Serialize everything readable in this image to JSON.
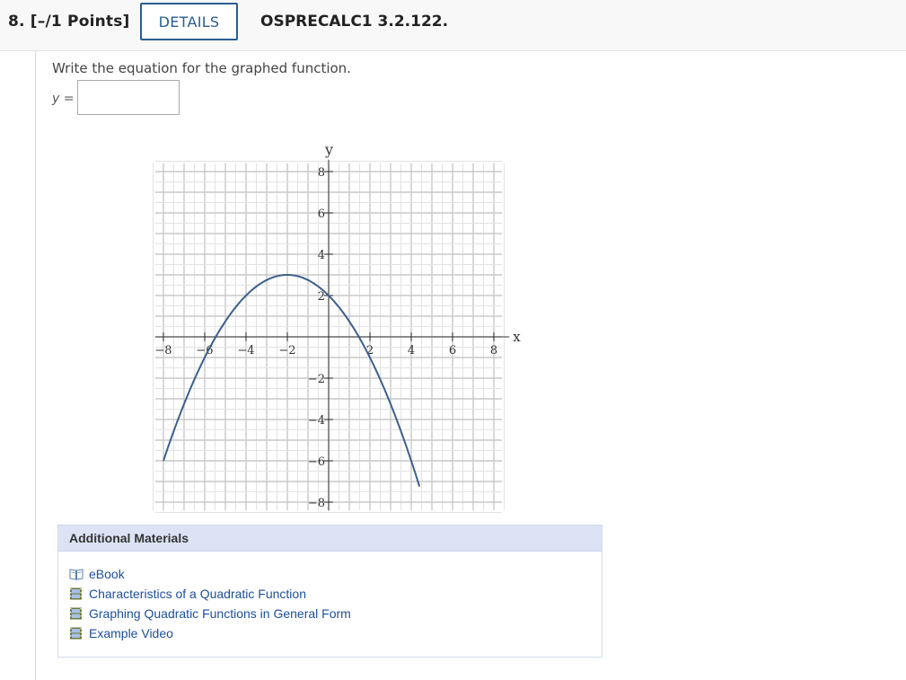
{
  "question": {
    "number_label": "8. [–/1 Points]",
    "details_label": "DETAILS",
    "course_code": "OSPRECALC1 3.2.122."
  },
  "prompt": {
    "text": "Write the equation for the graphed function.",
    "answer_label": "y =",
    "answer_value": ""
  },
  "chart_data": {
    "type": "line",
    "xlabel": "x",
    "ylabel": "y",
    "xlim": [
      -8,
      8
    ],
    "ylim": [
      -8,
      8
    ],
    "x_ticks": [
      "−8",
      "−6",
      "−4",
      "−2",
      "2",
      "4",
      "6",
      "8"
    ],
    "y_ticks": [
      "8",
      "6",
      "4",
      "2",
      "−2",
      "−4",
      "−6",
      "−8"
    ],
    "grid": true,
    "series": [
      {
        "points": [
          [
            -8,
            -7
          ],
          [
            -6,
            -1
          ],
          [
            -4,
            2
          ],
          [
            -2,
            3
          ],
          [
            0,
            2
          ],
          [
            2,
            -1
          ],
          [
            4,
            -6
          ],
          [
            4.4,
            -7.5
          ]
        ]
      }
    ],
    "curve_color": "#3c5f8d"
  },
  "materials": {
    "title": "Additional Materials",
    "items": [
      {
        "label": "eBook",
        "icon": "book-icon"
      },
      {
        "label": "Characteristics of a Quadratic Function",
        "icon": "film-icon"
      },
      {
        "label": "Graphing Quadratic Functions in General Form",
        "icon": "film-icon"
      },
      {
        "label": "Example Video",
        "icon": "film-icon"
      }
    ]
  }
}
